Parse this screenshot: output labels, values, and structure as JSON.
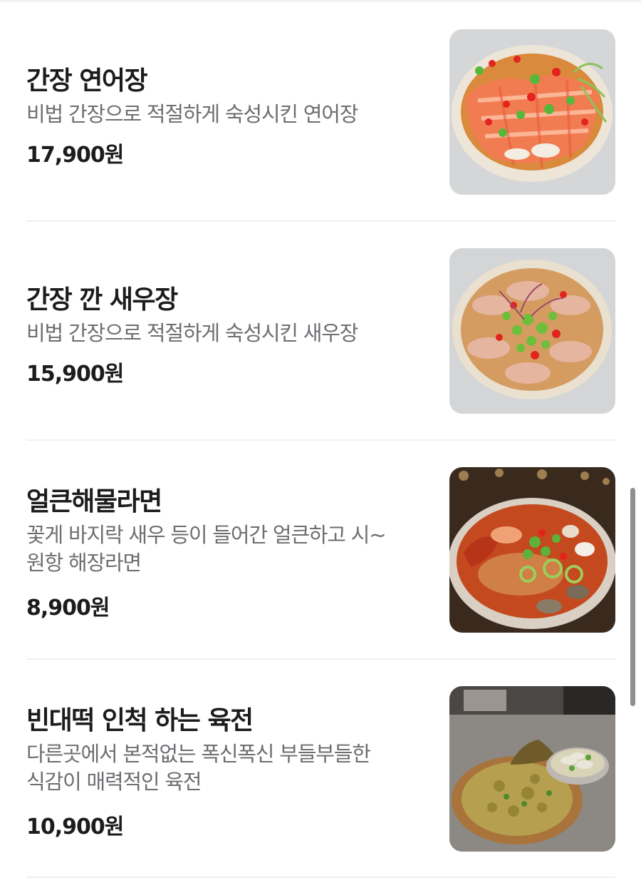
{
  "menu": {
    "items": [
      {
        "name": "간장 연어장",
        "description": [
          "비법 간장으로 적절하게 숙성시킨 연어장"
        ],
        "price": "17,900원",
        "image": "salmon-jang-photo"
      },
      {
        "name": "간장 깐 새우장",
        "description": [
          "비법 간장으로 적절하게 숙성시킨 새우장"
        ],
        "price": "15,900원",
        "image": "shrimp-jang-photo"
      },
      {
        "name": "얼큰해물라면",
        "description": [
          "꽃게 바지락 새우 등이 들어간 얼큰하고 시~",
          "원항 해장라면"
        ],
        "price": "8,900원",
        "image": "seafood-ramen-photo"
      },
      {
        "name": "빈대떡 인척 하는 육전",
        "description": [
          "다른곳에서 본적없는 폭신폭신 부들부들한",
          "식감이 매력적인 육전"
        ],
        "price": "10,900원",
        "image": "yukjeon-photo"
      }
    ]
  },
  "colors": {
    "text": "#1c1c1e",
    "secondary_text": "#6d6d72",
    "divider": "#f0f0f2",
    "scrollbar": "#8e8e93"
  }
}
